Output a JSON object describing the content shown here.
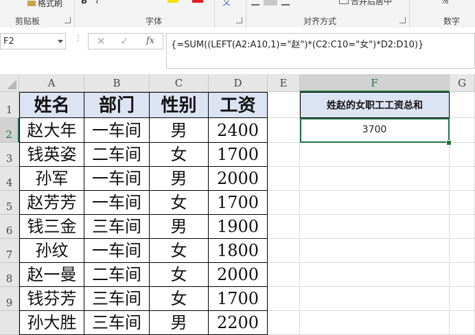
{
  "ribbon": {
    "clipboard_label": "剪贴板",
    "format_painter_label": "格式刷",
    "font_group_label": "字体",
    "alignment_group_label": "对齐方式",
    "merge_label": "合并后居中",
    "number_group_label": "数字",
    "percent_label": "%"
  },
  "formula_bar": {
    "name_box": "F2",
    "cancel_symbol": "✕",
    "enter_symbol": "✓",
    "fx_symbol": "fx",
    "formula": "{=SUM((LEFT(A2:A10,1)=\"赵\")*(C2:C10=\"女\")*D2:D10)}"
  },
  "columns": [
    "A",
    "B",
    "C",
    "D",
    "E",
    "F",
    "G"
  ],
  "rows": [
    "1",
    "2",
    "3",
    "4",
    "5",
    "6",
    "7",
    "8",
    "9"
  ],
  "table": {
    "headers": [
      "姓名",
      "部门",
      "性别",
      "工资"
    ],
    "data": [
      [
        "赵大年",
        "一车间",
        "男",
        "2400"
      ],
      [
        "钱英姿",
        "二车间",
        "女",
        "1700"
      ],
      [
        "孙军",
        "一车间",
        "男",
        "2000"
      ],
      [
        "赵芳芳",
        "一车间",
        "女",
        "1700"
      ],
      [
        "钱三金",
        "三车间",
        "男",
        "1900"
      ],
      [
        "孙纹",
        "一车间",
        "女",
        "1800"
      ],
      [
        "赵一曼",
        "二车间",
        "女",
        "2000"
      ],
      [
        "钱芬芳",
        "三车间",
        "女",
        "1700"
      ],
      [
        "孙大胜",
        "三车间",
        "男",
        "2200"
      ]
    ]
  },
  "result": {
    "header": "姓赵的女职工工资总和",
    "value": "3700"
  },
  "colors": {
    "header_fill": "#dce3f3",
    "selection": "#217346"
  }
}
